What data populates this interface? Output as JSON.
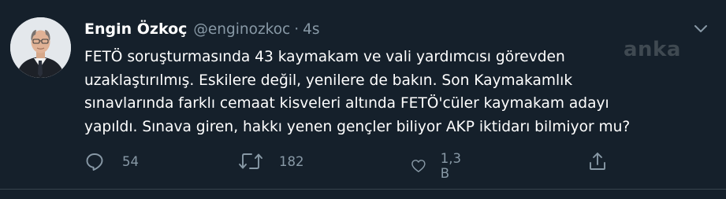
{
  "tweet": {
    "author_name": "Engin Özkoç",
    "handle": "@enginozkoc",
    "separator": "·",
    "time": "4s",
    "text_lines": [
      "FETÖ soruşturmasında 43 kaymakam ve vali yardımcısı görevden",
      "uzaklaştırılmış. Eskilere değil, yenilere de bakın. Son Kaymakamlık",
      "sınavlarında farklı cemaat kisveleri altında FETÖ'cüler kaymakam adayı",
      "yapıldı. Sınava giren, hakkı yenen gençler biliyor AKP iktidarı bilmiyor mu?"
    ],
    "watermark": "anka",
    "actions": {
      "reply_count": "54",
      "retweet_count": "182",
      "like_count": "1,3 B"
    }
  },
  "icons": {
    "reply": "reply-icon",
    "retweet": "retweet-icon",
    "like": "heart-icon",
    "share": "share-icon",
    "menu": "chevron-down-icon"
  },
  "colors": {
    "background": "#15202b",
    "primary_text": "#ffffff",
    "secondary_text": "#8899a6",
    "border": "#38444d"
  }
}
